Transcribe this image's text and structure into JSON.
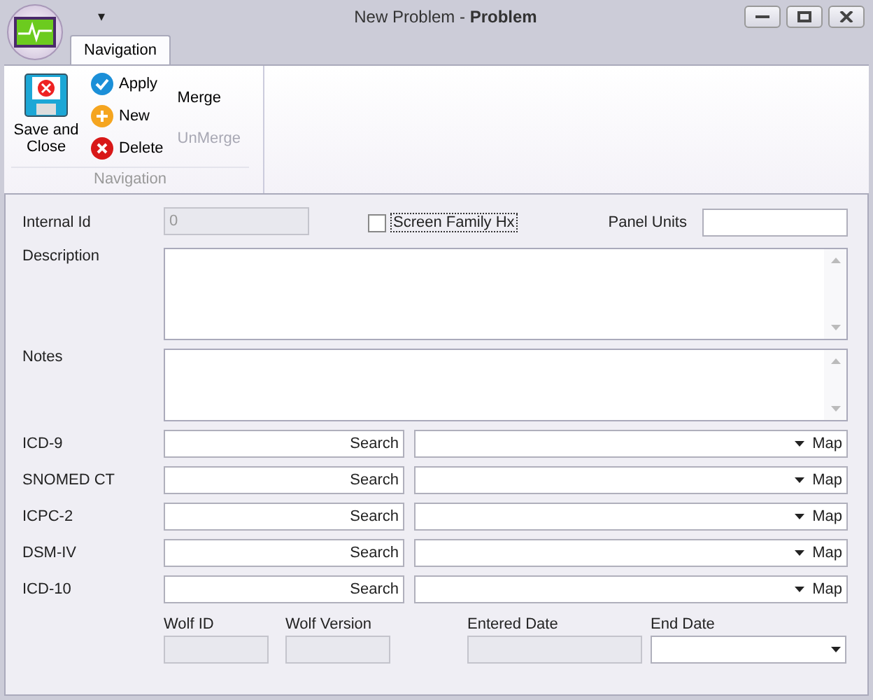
{
  "window": {
    "title": "New Problem - **Problem**"
  },
  "quick_access": {
    "menu": "▾"
  },
  "tabs": [
    {
      "label": "Navigation",
      "selected": true
    }
  ],
  "ribbon": {
    "group_label": "Navigation",
    "big_button": {
      "label": "Save and Close"
    },
    "small_buttons": [
      {
        "label": "Apply",
        "kind": "apply",
        "disabled": false
      },
      {
        "label": "New",
        "kind": "new",
        "disabled": false
      },
      {
        "label": "Delete",
        "kind": "delete",
        "disabled": false
      }
    ],
    "text_buttons": [
      {
        "label": "Merge",
        "disabled": false
      },
      {
        "label": "UnMerge",
        "disabled": true
      }
    ]
  },
  "form": {
    "internal_id": {
      "label": "Internal Id",
      "value": "0",
      "disabled": true
    },
    "screen_family": {
      "label": "Screen Family Hx",
      "checked": false
    },
    "panel_units": {
      "label": "Panel Units"
    },
    "description": {
      "label": "Description"
    },
    "notes": {
      "label": "Notes"
    },
    "codes": [
      {
        "label": "ICD-9",
        "search": "Search",
        "map": "Map"
      },
      {
        "label": "SNOMED CT",
        "search": "Search",
        "map": "Map"
      },
      {
        "label": "ICPC-2",
        "search": "Search",
        "map": "Map"
      },
      {
        "label": "DSM-IV",
        "search": "Search",
        "map": "Map"
      },
      {
        "label": "ICD-10",
        "search": "Search",
        "map": "Map"
      }
    ],
    "bottom_fields": [
      {
        "label": "Wolf ID",
        "kind": "readonly"
      },
      {
        "label": "Wolf Version",
        "kind": "readonly"
      },
      {
        "label": "Entered Date",
        "kind": "readonly"
      },
      {
        "label": "End Date",
        "kind": "dropdown"
      }
    ]
  }
}
